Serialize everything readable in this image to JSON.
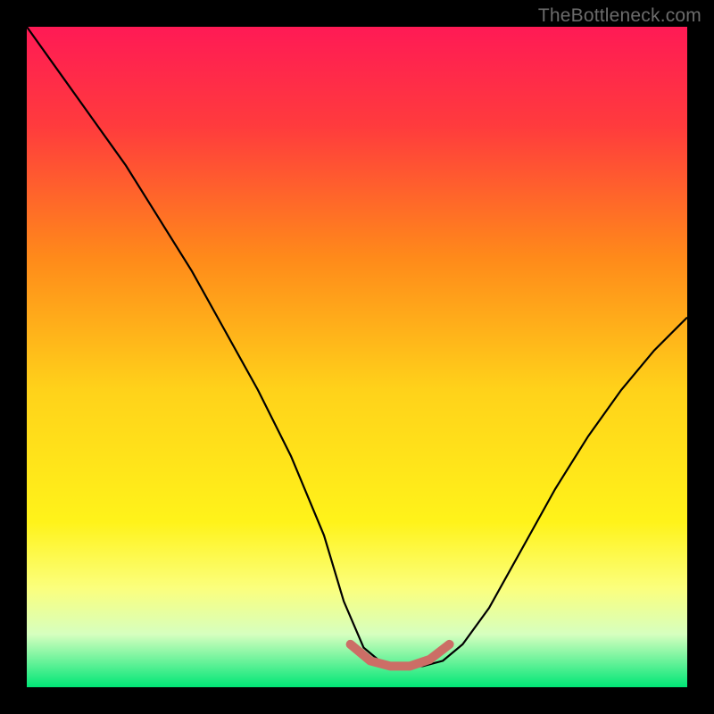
{
  "watermark": "TheBottleneck.com",
  "chart_data": {
    "type": "line",
    "title": "",
    "xlabel": "",
    "ylabel": "",
    "xlim": [
      0,
      100
    ],
    "ylim": [
      0,
      100
    ],
    "background_gradient": [
      {
        "stop": 0.0,
        "color": "#ff1a55"
      },
      {
        "stop": 0.15,
        "color": "#ff3b3d"
      },
      {
        "stop": 0.35,
        "color": "#ff8a1a"
      },
      {
        "stop": 0.55,
        "color": "#ffd21a"
      },
      {
        "stop": 0.75,
        "color": "#fff31a"
      },
      {
        "stop": 0.85,
        "color": "#fbff7d"
      },
      {
        "stop": 0.92,
        "color": "#d6ffbf"
      },
      {
        "stop": 1.0,
        "color": "#00e676"
      }
    ],
    "series": [
      {
        "name": "curve",
        "color": "#000000",
        "width": 2.2,
        "x": [
          0,
          5,
          10,
          15,
          20,
          25,
          30,
          35,
          40,
          45,
          48,
          51,
          54,
          57,
          60,
          63,
          66,
          70,
          75,
          80,
          85,
          90,
          95,
          100
        ],
        "y": [
          100,
          93,
          86,
          79,
          71,
          63,
          54,
          45,
          35,
          23,
          13,
          6,
          3.5,
          3,
          3.2,
          4,
          6.5,
          12,
          21,
          30,
          38,
          45,
          51,
          56
        ]
      },
      {
        "name": "valley-marker",
        "color": "#cc6e66",
        "width": 10,
        "linecap": "round",
        "x": [
          49,
          52,
          55,
          58,
          61,
          64
        ],
        "y": [
          6.5,
          4,
          3.2,
          3.2,
          4.2,
          6.5
        ]
      }
    ]
  }
}
